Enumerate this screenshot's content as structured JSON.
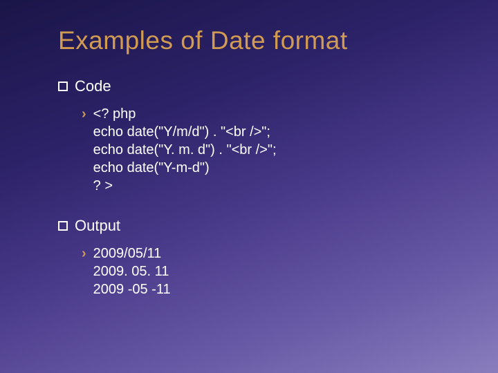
{
  "title": "Examples of Date format",
  "sections": [
    {
      "label": "Code",
      "body": "<? php\necho date(\"Y/m/d\") . \"<br />\";\necho date(\"Y. m. d\") . \"<br />\";\necho date(\"Y-m-d\")\n? >"
    },
    {
      "label": "Output",
      "body": "2009/05/11\n2009. 05. 11\n2009 -05 -11"
    }
  ]
}
